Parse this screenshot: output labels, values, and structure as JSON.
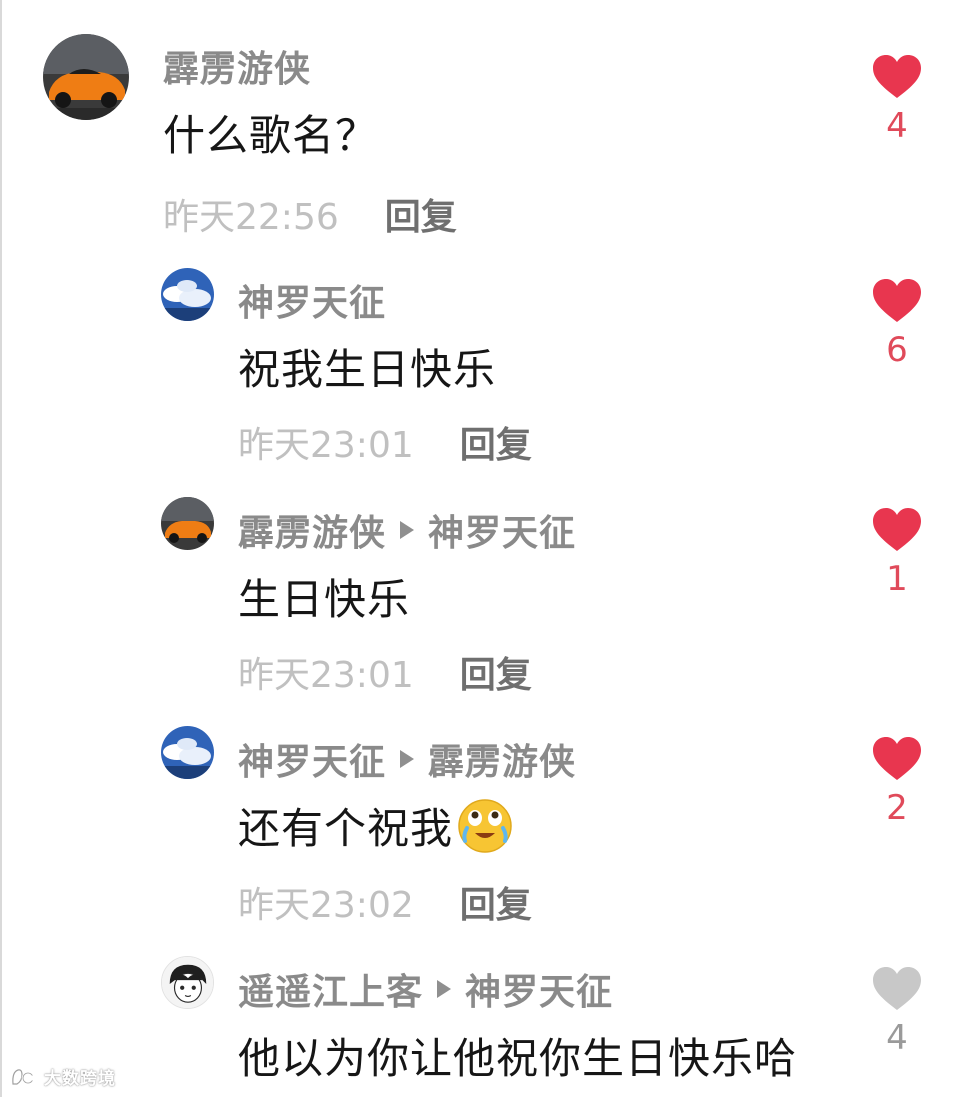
{
  "comments": [
    {
      "author": "霹雳游侠",
      "reply_to": "",
      "text": "什么歌名？",
      "time": "昨天22:56",
      "reply_label": "回复",
      "likes": "4",
      "liked": true,
      "avatar": "orange-sports-car"
    },
    {
      "author": "神罗天征",
      "reply_to": "",
      "text": "祝我生日快乐",
      "time": "昨天23:01",
      "reply_label": "回复",
      "likes": "6",
      "liked": true,
      "avatar": "blue-sky-clouds"
    },
    {
      "author": "霹雳游侠",
      "reply_to": "神罗天征",
      "text": "生日快乐",
      "time": "昨天23:01",
      "reply_label": "回复",
      "likes": "1",
      "liked": true,
      "avatar": "orange-sports-car"
    },
    {
      "author": "神罗天征",
      "reply_to": "霹雳游侠",
      "text": "还有个祝我",
      "emoji": "crying-laughing-emoji",
      "time": "昨天23:02",
      "reply_label": "回复",
      "likes": "2",
      "liked": true,
      "avatar": "blue-sky-clouds"
    },
    {
      "author": "遥遥江上客",
      "reply_to": "神罗天征",
      "text": "他以为你让他祝你生日快乐哈",
      "likes": "4",
      "liked": false,
      "avatar": "manga-boy-sketch"
    }
  ],
  "colors": {
    "liked_heart": "#e8364f",
    "unliked_heart": "#c8c8c8",
    "author": "#8a8a8a",
    "time": "#c0c0c0",
    "reply": "#6f6f6f"
  },
  "watermark": "大数跨境"
}
